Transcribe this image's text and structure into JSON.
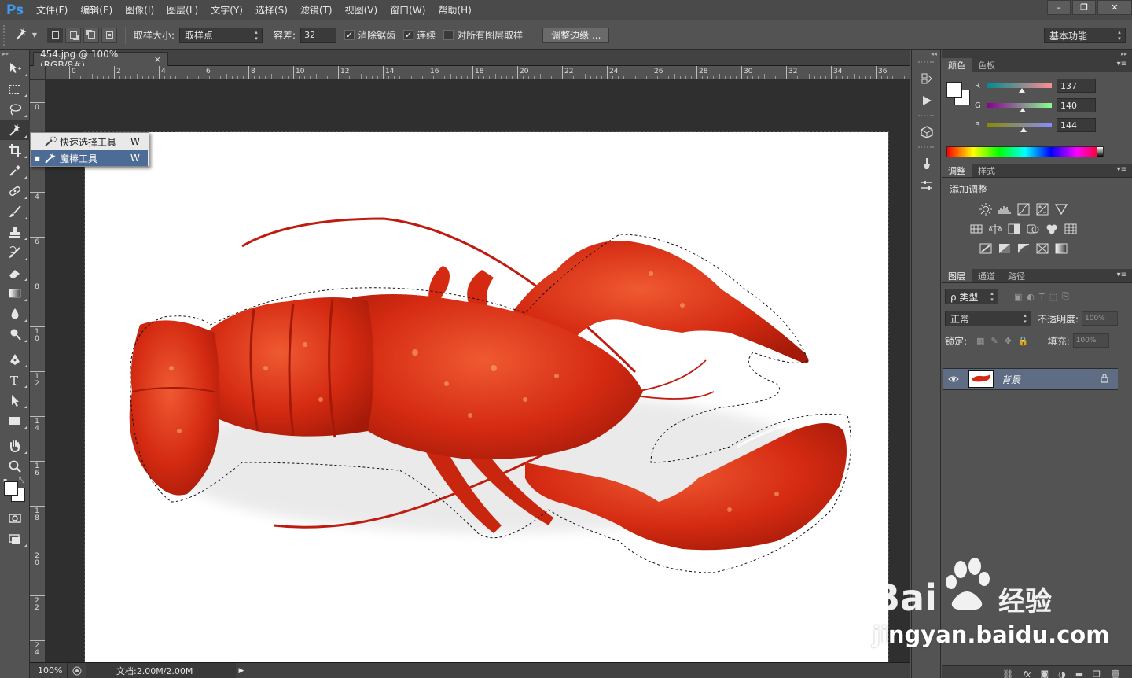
{
  "app": {
    "logo": "Ps"
  },
  "menu": [
    "文件(F)",
    "编辑(E)",
    "图像(I)",
    "图层(L)",
    "文字(Y)",
    "选择(S)",
    "滤镜(T)",
    "视图(V)",
    "窗口(W)",
    "帮助(H)"
  ],
  "window_buttons": [
    "–",
    "❐",
    "✕"
  ],
  "options": {
    "sample_size_label": "取样大小:",
    "sample_size_value": "取样点",
    "tolerance_label": "容差:",
    "tolerance_value": "32",
    "antialias_label": "消除锯齿",
    "antialias_checked": true,
    "contiguous_label": "连续",
    "contiguous_checked": true,
    "all_layers_label": "对所有图层取样",
    "all_layers_checked": false,
    "refine_edge_label": "调整边缘 ...",
    "workspace": "基本功能"
  },
  "flyout": {
    "items": [
      {
        "label": "快速选择工具",
        "key": "W",
        "selected": false
      },
      {
        "label": "魔棒工具",
        "key": "W",
        "selected": true
      }
    ]
  },
  "document": {
    "tab_title": "454.jpg @ 100%(RGB/8#)",
    "tab_close": "×",
    "ruler_top": [
      "0",
      "2",
      "4",
      "6",
      "8",
      "10",
      "12",
      "14",
      "16",
      "18",
      "20",
      "22",
      "24",
      "26",
      "28",
      "30",
      "32",
      "34",
      "36"
    ],
    "ruler_left": [
      "0",
      "2",
      "4",
      "6",
      "8",
      "10",
      "12",
      "14",
      "16",
      "18",
      "20",
      "22",
      "24"
    ]
  },
  "status": {
    "zoom": "100%",
    "doc_info": "文档:2.00M/2.00M",
    "arrow": "▶"
  },
  "color_panel": {
    "tabs": [
      "颜色",
      "色板"
    ],
    "r_label": "R",
    "g_label": "G",
    "b_label": "B",
    "r": "137",
    "g": "140",
    "b": "144",
    "r_level": 0.537,
    "g_level": 0.549,
    "b_level": 0.565
  },
  "adjust_panel": {
    "tabs": [
      "调整",
      "样式"
    ],
    "title": "添加调整"
  },
  "layers_panel": {
    "tabs": [
      "图层",
      "通道",
      "路径"
    ],
    "filter_label": "ρ 类型",
    "blend_mode": "正常",
    "opacity_label": "不透明度:",
    "opacity_value": "100%",
    "lock_label": "锁定:",
    "fill_label": "填充:",
    "fill_value": "100%",
    "layer_name": "背景",
    "footer_icons": [
      "link-icon",
      "fx-icon",
      "mask-icon",
      "adjustment-icon",
      "folder-icon",
      "new-layer-icon",
      "trash-icon"
    ]
  },
  "watermark": {
    "text": "jingyan.baidu.com"
  },
  "colors": {
    "lobster": "#d42a12",
    "lobster_dark": "#a41a08",
    "selection_active_bg": "#5e6d84",
    "flyout_selected": "#4c6b95",
    "ps_blue": "#3c9cf0"
  }
}
